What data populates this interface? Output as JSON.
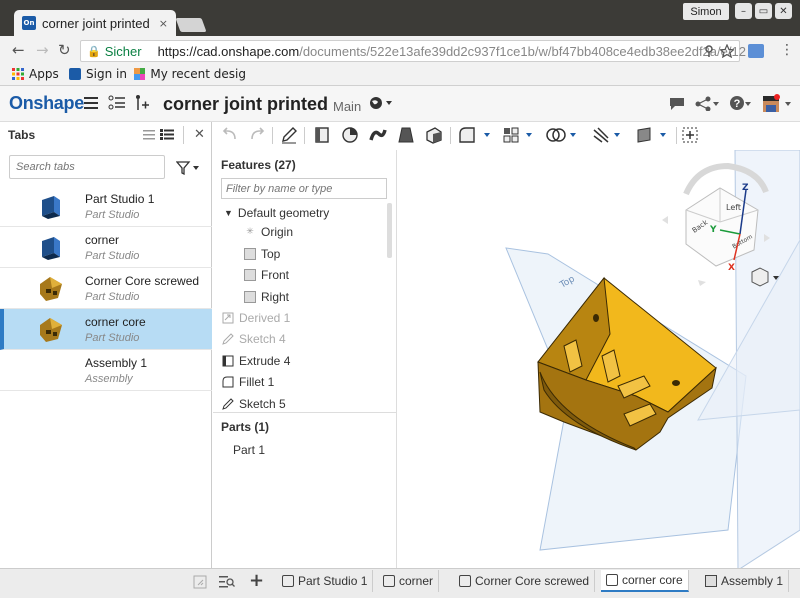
{
  "browser": {
    "tab_title": "corner joint printed",
    "tab_close": "×",
    "user": "Simon",
    "secure_label": "Sicher",
    "url_host": "https://cad.onshape.com",
    "url_path": "/documents/522e13afe39dd2c937f1ce1b/w/bf47bb408ce4edb38ee2df2a/e/12",
    "bookmarks": [
      {
        "label": "Apps",
        "icon": "apps-grid-icon"
      },
      {
        "label": "Sign in",
        "icon": "onshape-favicon"
      },
      {
        "label": "My recent desig",
        "icon": "colorful-grid-icon"
      }
    ]
  },
  "app": {
    "logo": "Onshape",
    "doc_title": "corner joint printed",
    "branch": "Main",
    "favicon_text": "On"
  },
  "tabs_panel": {
    "title": "Tabs",
    "search_placeholder": "Search tabs",
    "items": [
      {
        "name": "Part Studio 1",
        "type": "Part Studio",
        "thumb": "plate"
      },
      {
        "name": "corner",
        "type": "Part Studio",
        "thumb": "plate"
      },
      {
        "name": "Corner Core screwed",
        "type": "Part Studio",
        "thumb": "core"
      },
      {
        "name": "corner core",
        "type": "Part Studio",
        "thumb": "core",
        "active": true
      },
      {
        "name": "Assembly 1",
        "type": "Assembly",
        "thumb": "none"
      }
    ]
  },
  "features": {
    "title": "Features (27)",
    "filter_placeholder": "Filter by name or type",
    "default_geometry": "Default geometry",
    "geometry": [
      "Origin",
      "Top",
      "Front",
      "Right"
    ],
    "items": [
      {
        "label": "Derived 1",
        "dim": true,
        "icon": "derived-icon"
      },
      {
        "label": "Sketch 4",
        "dim": true,
        "icon": "sketch-icon"
      },
      {
        "label": "Extrude 4",
        "dim": false,
        "icon": "extrude-icon"
      },
      {
        "label": "Fillet 1",
        "dim": false,
        "icon": "fillet-icon"
      },
      {
        "label": "Sketch 5",
        "dim": false,
        "icon": "sketch-icon"
      }
    ],
    "parts_title": "Parts (1)",
    "parts": [
      "Part 1"
    ]
  },
  "viewcube": {
    "faces": [
      "Left",
      "Back",
      "Bottom"
    ],
    "axes": [
      "Z",
      "Y",
      "X"
    ]
  },
  "bottom_tabs": [
    {
      "label": "Part Studio 1"
    },
    {
      "label": "corner"
    },
    {
      "label": "Corner Core screwed"
    },
    {
      "label": "corner core",
      "active": true
    },
    {
      "label": "Assembly 1"
    }
  ],
  "colors": {
    "brand": "#1b5ba7",
    "active_tab": "#b7dcf4",
    "part_fill": "#d9a30d"
  }
}
